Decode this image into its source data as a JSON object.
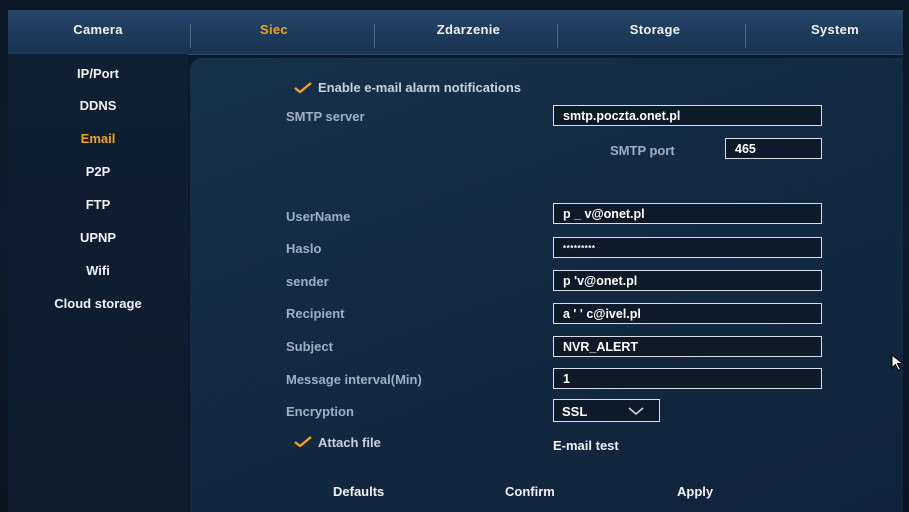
{
  "tabs": [
    {
      "label": "Camera",
      "active": false
    },
    {
      "label": "Siec",
      "active": true
    },
    {
      "label": "Zdarzenie",
      "active": false
    },
    {
      "label": "Storage",
      "active": false
    },
    {
      "label": "System",
      "active": false
    }
  ],
  "sidebar": {
    "items": [
      {
        "label": "IP/Port",
        "active": false
      },
      {
        "label": "DDNS",
        "active": false
      },
      {
        "label": "Email",
        "active": true
      },
      {
        "label": "P2P",
        "active": false
      },
      {
        "label": "FTP",
        "active": false
      },
      {
        "label": "UPNP",
        "active": false
      },
      {
        "label": "Wifi",
        "active": false
      },
      {
        "label": "Cloud storage",
        "active": false
      }
    ]
  },
  "email": {
    "enable_label": "Enable e-mail alarm notifications",
    "enable_checked": true,
    "smtp_server_label": "SMTP server",
    "smtp_server_value": "smtp.poczta.onet.pl",
    "smtp_port_label": "SMTP port",
    "smtp_port_value": "465",
    "username_label": "UserName",
    "username_value": "p      _    v@onet.pl",
    "password_label": "Haslo",
    "password_value": "*********",
    "sender_label": "sender",
    "sender_value": "p               'v@onet.pl",
    "recipient_label": "Recipient",
    "recipient_value": "a   '    ' c@ivel.pl",
    "subject_label": "Subject",
    "subject_value": "NVR_ALERT",
    "interval_label": "Message interval(Min)",
    "interval_value": "1",
    "encryption_label": "Encryption",
    "encryption_value": "SSL",
    "attach_label": "Attach file",
    "attach_checked": true,
    "test_label": "E-mail test"
  },
  "buttons": {
    "defaults": "Defaults",
    "confirm": "Confirm",
    "apply": "Apply"
  },
  "colors": {
    "accent": "#f0a21e",
    "label": "#9fb0c3",
    "text": "#f0f2f5"
  },
  "icons": {
    "check": "checkmark-icon",
    "dropdown": "chevron-down-icon",
    "pointer": "mouse-pointer-icon"
  }
}
